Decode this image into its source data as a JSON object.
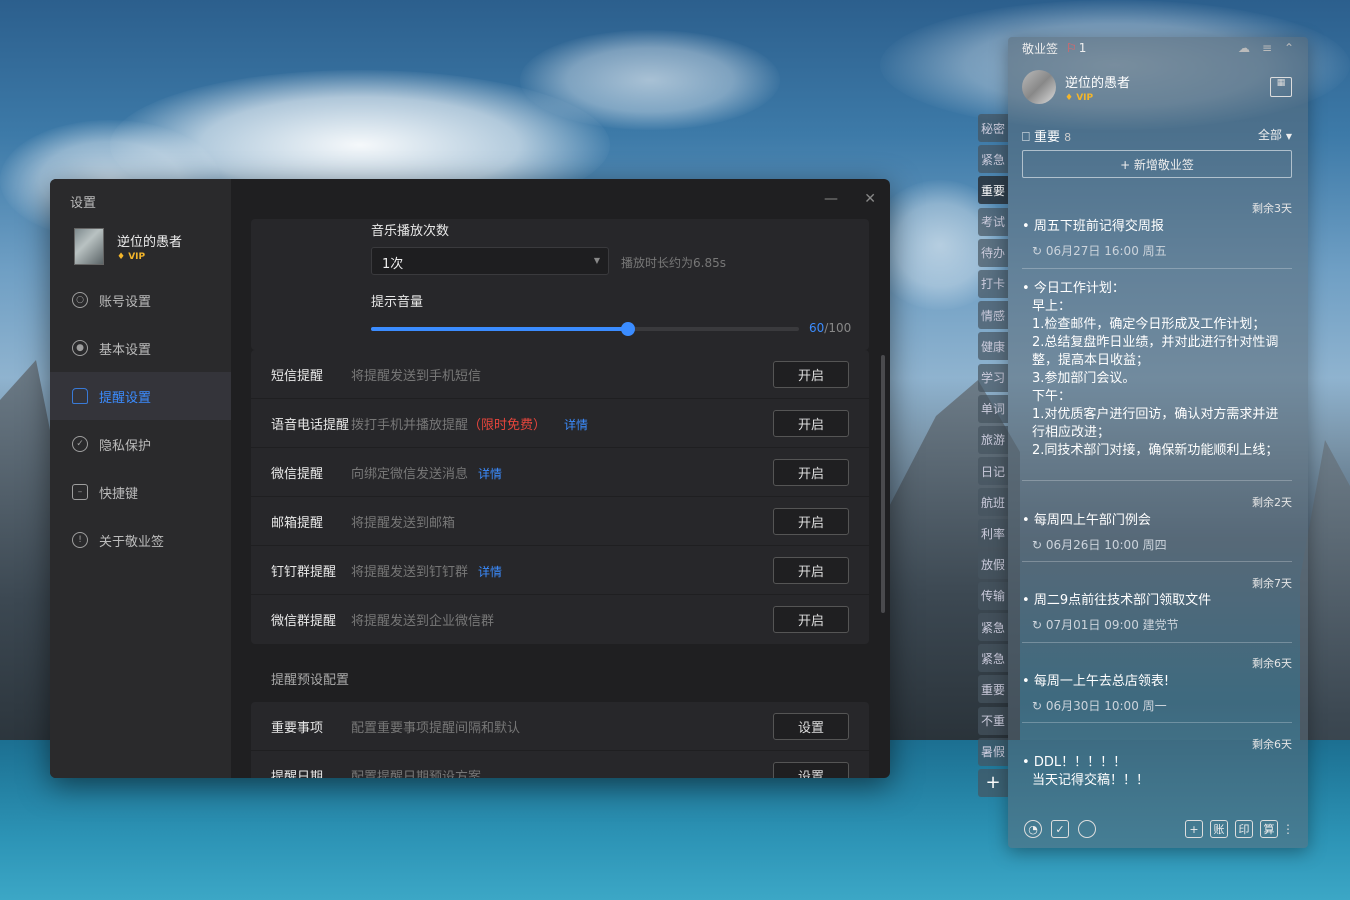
{
  "settings": {
    "window_title": "设置",
    "user_name": "逆位的愚者",
    "vip": "VIP",
    "nav": [
      {
        "label": "账号设置",
        "icon": "account-icon"
      },
      {
        "label": "基本设置",
        "icon": "settings-icon"
      },
      {
        "label": "提醒设置",
        "icon": "bell-icon"
      },
      {
        "label": "隐私保护",
        "icon": "shield-icon"
      },
      {
        "label": "快捷键",
        "icon": "keyboard-icon"
      },
      {
        "label": "关于敬业签",
        "icon": "info-icon"
      }
    ],
    "active_nav": "提醒设置",
    "music_play_count_label": "音乐播放次数",
    "music_play_count_value": "1次",
    "play_duration_hint": "播放时长约为6.85s",
    "volume_label": "提示音量",
    "volume_value": "60",
    "volume_max": "/100",
    "volume_fraction": 0.6,
    "reminders": [
      {
        "label": "短信提醒",
        "desc": "将提醒发送到手机短信",
        "button": "开启"
      },
      {
        "label": "语音电话提醒",
        "desc": "拨打手机并播放提醒",
        "free": "（限时免费）",
        "link": "详情",
        "button": "开启"
      },
      {
        "label": "微信提醒",
        "desc": "向绑定微信发送消息",
        "link": "详情",
        "button": "开启"
      },
      {
        "label": "邮箱提醒",
        "desc": "将提醒发送到邮箱",
        "button": "开启"
      },
      {
        "label": "钉钉群提醒",
        "desc": "将提醒发送到钉钉群",
        "link": "详情",
        "button": "开启"
      },
      {
        "label": "微信群提醒",
        "desc": "将提醒发送到企业微信群",
        "button": "开启"
      }
    ],
    "preset_section_title": "提醒预设配置",
    "presets": [
      {
        "label": "重要事项",
        "desc": "配置重要事项提醒间隔和默认",
        "button": "设置"
      },
      {
        "label": "提醒日期",
        "desc": "配置提醒日期预设方案",
        "button": "设置"
      }
    ]
  },
  "sticky": {
    "app_name": "敬业签",
    "notify_count": "1",
    "user_name": "逆位的愚者",
    "vip": "VIP",
    "category": "重要",
    "category_count": "8",
    "filter": "全部",
    "add_button": "+ 新增敬业签",
    "tabs": [
      "秘密",
      "紧急",
      "重要",
      "考试",
      "待办",
      "打卡",
      "情感",
      "健康",
      "学习",
      "单词",
      "旅游",
      "日记",
      "航班",
      "利率",
      "放假",
      "传输",
      "紧急",
      "紧急",
      "重要",
      "不重",
      "暑假"
    ],
    "add_tab": "+",
    "notes": [
      {
        "remain": "剩余3天",
        "lines": [
          "周五下班前记得交周报"
        ],
        "meta": "06月27日 16:00 周五"
      },
      {
        "remain": "",
        "lines": [
          "今日工作计划：",
          "早上：",
          "1.检查邮件，确定今日形成及工作计划；",
          "2.总结复盘昨日业绩，并对此进行针对性调",
          "整，提高本日收益；",
          "3.参加部门会议。",
          "下午：",
          "1.对优质客户进行回访，确认对方需求并进",
          "行相应改进；",
          "2.同技术部门对接，确保新功能顺利上线；"
        ],
        "meta": ""
      },
      {
        "remain": "剩余2天",
        "lines": [
          "每周四上午部门例会"
        ],
        "meta": "06月26日 10:00 周四"
      },
      {
        "remain": "剩余7天",
        "lines": [
          "周二9点前往技术部门领取文件"
        ],
        "meta": "07月01日 09:00 建党节"
      },
      {
        "remain": "剩余6天",
        "lines": [
          "每周一上午去总店领表!"
        ],
        "meta": "06月30日 10:00 周一"
      },
      {
        "remain": "剩余6天",
        "lines": [
          "DDL！！！！！",
          "当天记得交稿！！！"
        ],
        "meta": ""
      }
    ],
    "footer_right": [
      "+",
      "账",
      "印",
      "算"
    ]
  }
}
